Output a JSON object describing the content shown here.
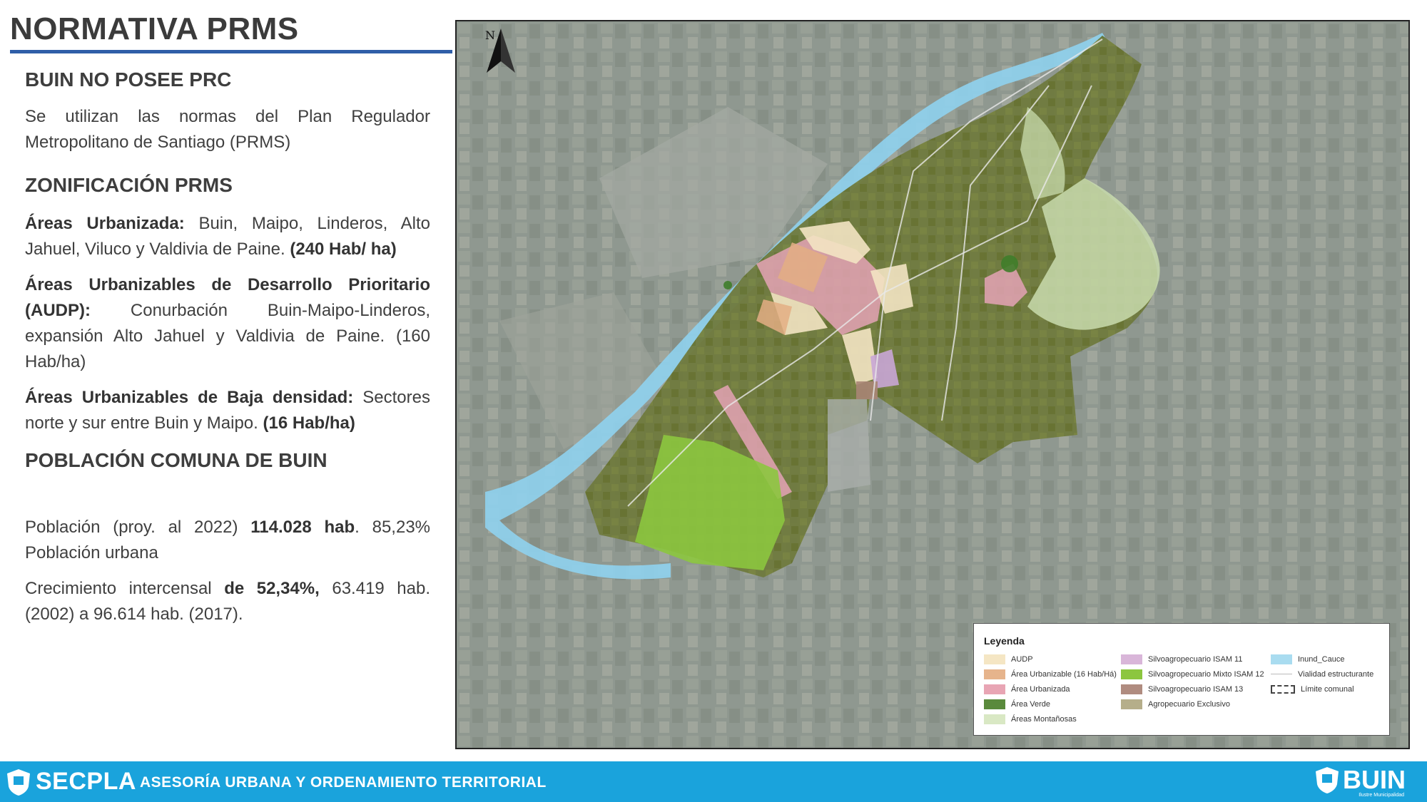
{
  "header": {
    "title": "NORMATIVA PRMS"
  },
  "left": {
    "section1_title": "BUIN NO POSEE  PRC",
    "section1_text": "Se utilizan las normas del Plan Regulador Metropolitano de Santiago (PRMS)",
    "section2_title": "ZONIFICACIÓN PRMS",
    "urbanizada_label": "Áreas Urbanizada:",
    "urbanizada_text": " Buin, Maipo, Linderos, Alto Jahuel, Viluco y Valdivia de Paine. ",
    "urbanizada_density": "(240 Hab/ ha)",
    "audp_label": "Áreas Urbanizables de Desarrollo Prioritario (AUDP):",
    "audp_text": " Conurbación Buin-Maipo-Linderos, expansión Alto Jahuel y Valdivia de Paine. (160 Hab/ha)",
    "baja_label": "Áreas Urbanizables de Baja densidad:",
    "baja_text": " Sectores norte y sur entre Buin y Maipo. ",
    "baja_density": "(16 Hab/ha)",
    "section3_title": "POBLACIÓN COMUNA DE BUIN",
    "pob_text1": "Población (proy. al 2022) ",
    "pob_value": "114.028 hab",
    "pob_text2": ". 85,23% Población urbana",
    "crec_text1": "Crecimiento intercensal ",
    "crec_value": "de 52,34%,",
    "crec_text2": " 63.419 hab. (2002) a 96.614 hab. (2017)."
  },
  "map": {
    "north_label": "N",
    "legend_title": "Leyenda",
    "legend": [
      {
        "label": "AUDP",
        "color": "#f5e6c4"
      },
      {
        "label": "Silvoagropecuario ISAM 11",
        "color": "#d9b6d9"
      },
      {
        "label": "Inund_Cauce",
        "color": "#a9dcf0"
      },
      {
        "label": "Área Urbanizable (16 Hab/Há)",
        "color": "#e6b48c"
      },
      {
        "label": "Silvoagropecuario Mixto ISAM 12",
        "color": "#8cc63f"
      },
      {
        "label": "Vialidad estructurante",
        "color": "#ffffff"
      },
      {
        "label": "Área Urbanizada",
        "color": "#e8a5b4"
      },
      {
        "label": "Silvoagropecuario ISAM 13",
        "color": "#b08c80"
      },
      {
        "label": "Límite comunal",
        "color": "#444444"
      },
      {
        "label": "Área Verde",
        "color": "#5a8a3c"
      },
      {
        "label": "Agropecuario Exclusivo",
        "color": "#b5ae8a"
      },
      {
        "label": "",
        "color": ""
      },
      {
        "label": "Áreas Montañosas",
        "color": "#d9e8c4"
      }
    ]
  },
  "footer": {
    "left_brand": "SECPLA",
    "center_text": "ASESORÍA URBANA Y ORDENAMIENTO TERRITORIAL",
    "right_brand": "BUIN",
    "right_sub": "Ilustre Municipalidad"
  }
}
